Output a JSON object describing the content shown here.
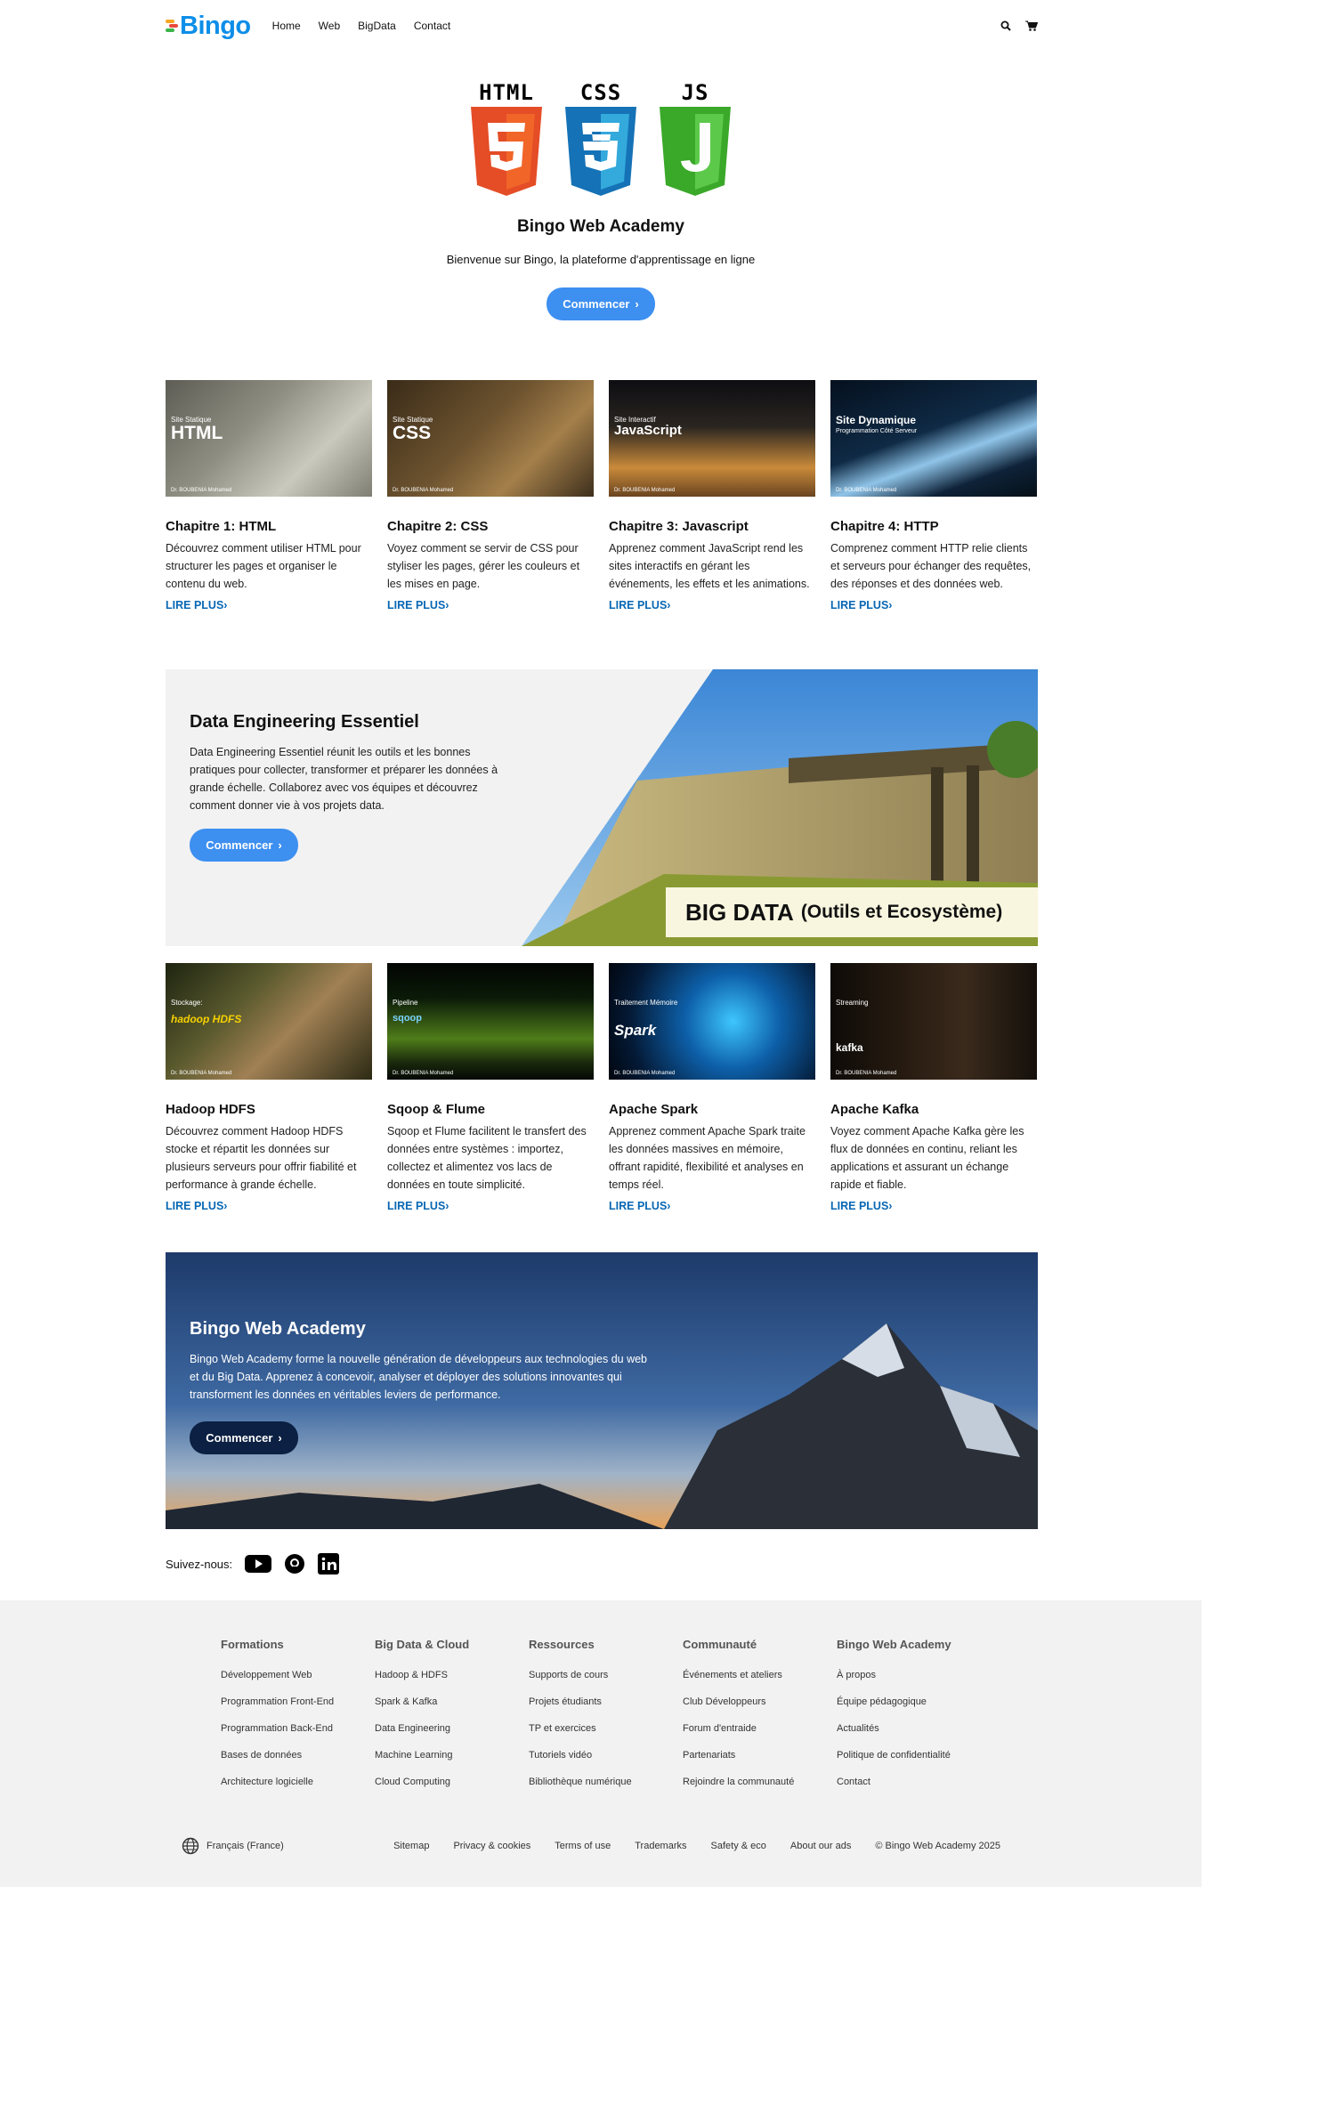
{
  "nav": {
    "logo": "Bingo",
    "links": [
      "Home",
      "Web",
      "BigData",
      "Contact"
    ]
  },
  "hero": {
    "badges": [
      "HTML",
      "CSS",
      "JS"
    ],
    "title": "Bingo Web Academy",
    "subtitle": "Bienvenue sur Bingo, la plateforme d'apprentissage en ligne",
    "button": "Commencer"
  },
  "web_cards": [
    {
      "thumb_tag": "Site Statique",
      "thumb_title": "HTML",
      "title": "Chapitre 1: HTML",
      "text": "Découvrez comment utiliser HTML pour structurer les pages et organiser le contenu du web.",
      "link": "LIRE PLUS"
    },
    {
      "thumb_tag": "Site Statique",
      "thumb_title": "CSS",
      "title": "Chapitre 2: CSS",
      "text": "Voyez comment se servir de CSS pour styliser les pages, gérer les couleurs et les mises en page.",
      "link": "LIRE PLUS"
    },
    {
      "thumb_tag": "Site Interactif",
      "thumb_title": "JavaScript",
      "title": "Chapitre 3: Javascript",
      "text": "Apprenez comment JavaScript rend les sites interactifs en gérant les événements, les effets et les animations.",
      "link": "LIRE PLUS"
    },
    {
      "thumb_tag": "Programmation Côté Serveur",
      "thumb_title": "Site Dynamique",
      "title": "Chapitre 4: HTTP",
      "text": "Comprenez comment HTTP relie clients et serveurs pour échanger des requêtes, des réponses et des données web.",
      "link": "LIRE PLUS"
    }
  ],
  "bigdata_banner": {
    "title": "Data Engineering Essentiel",
    "text": "Data Engineering Essentiel réunit les outils et les bonnes pratiques pour collecter, transformer et préparer les données à grande échelle. Collaborez avec vos équipes et découvrez comment donner vie à vos projets data.",
    "button": "Commencer",
    "image_caption_main": "BIG DATA",
    "image_caption_sub": "(Outils et Ecosystème)"
  },
  "bigdata_cards": [
    {
      "thumb_tag": "Stockage:",
      "thumb_title": "hadoop HDFS",
      "title": "Hadoop HDFS",
      "text": "Découvrez comment Hadoop HDFS stocke et répartit les données sur plusieurs serveurs pour offrir fiabilité et performance à grande échelle.",
      "link": "LIRE PLUS"
    },
    {
      "thumb_tag": "Pipeline",
      "thumb_title": "sqoop",
      "title": "Sqoop & Flume",
      "text": "Sqoop et Flume facilitent le transfert des données entre systèmes : importez, collectez et alimentez vos lacs de données en toute simplicité.",
      "link": "LIRE PLUS"
    },
    {
      "thumb_tag": "Traitement Mémoire",
      "thumb_title": "Spark",
      "title": "Apache Spark",
      "text": "Apprenez comment Apache Spark traite les données massives en mémoire, offrant rapidité, flexibilité et analyses en temps réel.",
      "link": "LIRE PLUS"
    },
    {
      "thumb_tag": "Streaming",
      "thumb_title": "kafka",
      "title": "Apache Kafka",
      "text": "Voyez comment Apache Kafka gère les flux de données en continu, reliant les applications et assurant un échange rapide et fiable.",
      "link": "LIRE PLUS"
    }
  ],
  "thumb_footer": "Dr. BOUBENIA Mohamed",
  "academy_banner": {
    "title": "Bingo Web Academy",
    "text": "Bingo Web Academy forme la nouvelle génération de développeurs aux technologies du web et du Big Data. Apprenez à concevoir, analyser et déployer des solutions innovantes qui transforment les données en véritables leviers de performance.",
    "button": "Commencer"
  },
  "social": {
    "label": "Suivez-nous:",
    "icons": [
      "youtube-icon",
      "github-icon",
      "linkedin-icon"
    ]
  },
  "footer": {
    "columns": [
      {
        "title": "Formations",
        "items": [
          "Développement Web",
          "Programmation Front-End",
          "Programmation Back-End",
          "Bases de données",
          "Architecture logicielle"
        ]
      },
      {
        "title": "Big Data & Cloud",
        "items": [
          "Hadoop & HDFS",
          "Spark & Kafka",
          "Data Engineering",
          "Machine Learning",
          "Cloud Computing"
        ]
      },
      {
        "title": "Ressources",
        "items": [
          "Supports de cours",
          "Projets étudiants",
          "TP et exercices",
          "Tutoriels vidéo",
          "Bibliothèque numérique"
        ]
      },
      {
        "title": "Communauté",
        "items": [
          "Événements et ateliers",
          "Club Développeurs",
          "Forum d'entraide",
          "Partenariats",
          "Rejoindre la communauté"
        ]
      },
      {
        "title": "Bingo Web Academy",
        "items": [
          "À propos",
          "Équipe pédagogique",
          "Actualités",
          "Politique de confidentialité",
          "Contact"
        ]
      }
    ],
    "locale": "Français (France)",
    "links": [
      "Sitemap",
      "Privacy & cookies",
      "Terms of use",
      "Trademarks",
      "Safety & eco",
      "About our ads",
      "© Bingo Web Academy 2025"
    ]
  },
  "colors": {
    "accent": "#3d8ff0",
    "link": "#0767b4",
    "dark_button": "#0b2042",
    "footer_bg": "#f2f2f2"
  }
}
